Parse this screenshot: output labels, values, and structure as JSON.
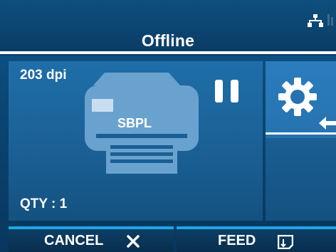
{
  "status": {
    "title": "Offline",
    "icons": [
      "network-icon",
      "dimmed-indicator-icon"
    ]
  },
  "main": {
    "dpi": "203 dpi",
    "printer_label": "SBPL",
    "qty": "QTY : 1",
    "pause_icon": "pause-icon",
    "printer_icon": "printer-icon"
  },
  "settings": {
    "icon": "gear-icon",
    "arrow_icon": "arrow-left-icon"
  },
  "softkeys": {
    "cancel": {
      "label": "CANCEL",
      "icon": "close-icon"
    },
    "feed": {
      "label": "FEED",
      "icon": "feed-paper-icon"
    }
  },
  "colors": {
    "background": "#0a4775",
    "panel": "#1f6ea9",
    "tile": "#2b7dbd",
    "softkey_accent": "#22a3e8",
    "text": "#ffffff"
  }
}
